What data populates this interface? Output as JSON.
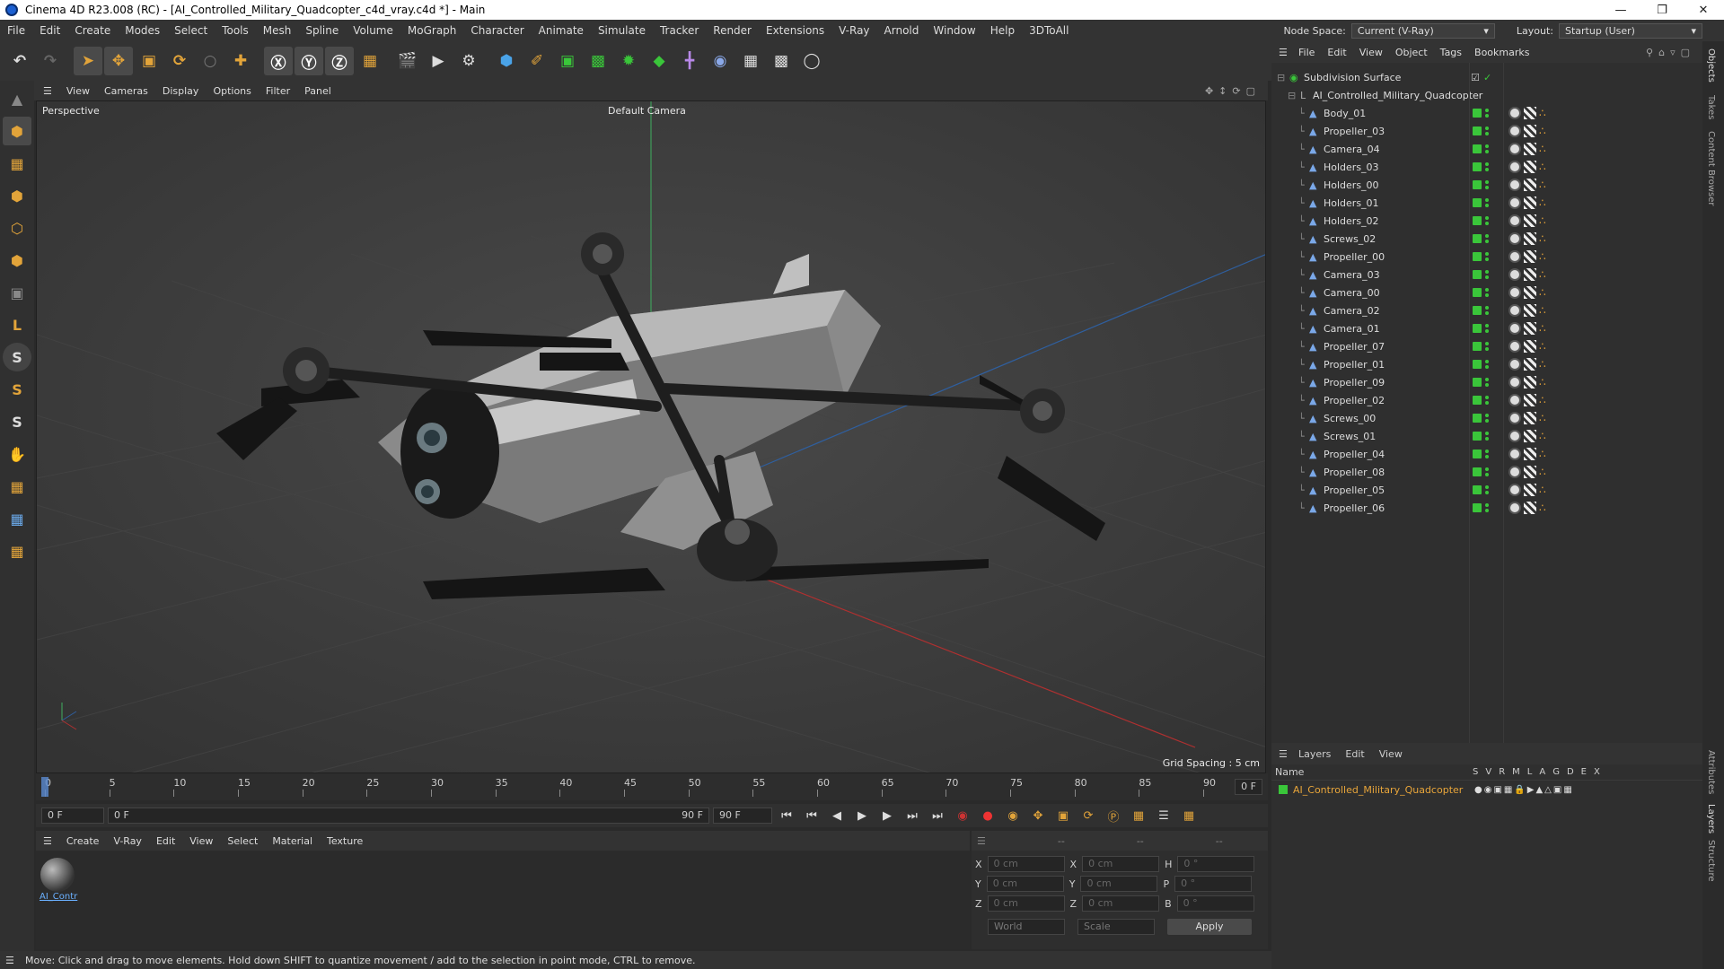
{
  "window": {
    "title": "Cinema 4D R23.008 (RC) - [AI_Controlled_Military_Quadcopter_c4d_vray.c4d *] - Main"
  },
  "menu": [
    "File",
    "Edit",
    "Create",
    "Modes",
    "Select",
    "Tools",
    "Mesh",
    "Spline",
    "Volume",
    "MoGraph",
    "Character",
    "Animate",
    "Simulate",
    "Tracker",
    "Render",
    "Extensions",
    "V-Ray",
    "Arnold",
    "Window",
    "Help",
    "3DToAll"
  ],
  "node_space": {
    "label": "Node Space:",
    "value": "Current (V-Ray)"
  },
  "layout": {
    "label": "Layout:",
    "value": "Startup (User)"
  },
  "viewport": {
    "menu": [
      "View",
      "Cameras",
      "Display",
      "Options",
      "Filter",
      "Panel"
    ],
    "label": "Perspective",
    "camera": "Default Camera",
    "grid_spacing": "Grid Spacing : 5 cm"
  },
  "timeline": {
    "ticks": [
      "0",
      "5",
      "10",
      "15",
      "20",
      "25",
      "30",
      "35",
      "40",
      "45",
      "50",
      "55",
      "60",
      "65",
      "70",
      "75",
      "80",
      "85",
      "90"
    ],
    "current_field": "0 F",
    "start": "0 F",
    "range_start": "0 F",
    "range_end": "90 F",
    "end": "90 F"
  },
  "material_panel": {
    "menu": [
      "Create",
      "V-Ray",
      "Edit",
      "View",
      "Select",
      "Material",
      "Texture"
    ],
    "material_name": "AI_Contr"
  },
  "coords": {
    "rows": [
      {
        "axis": "X",
        "pos": "0 cm",
        "axis2": "X",
        "size": "0 cm",
        "axis3": "H",
        "rot": "0 °"
      },
      {
        "axis": "Y",
        "pos": "0 cm",
        "axis2": "Y",
        "size": "0 cm",
        "axis3": "P",
        "rot": "0 °"
      },
      {
        "axis": "Z",
        "pos": "0 cm",
        "axis2": "Z",
        "size": "0 cm",
        "axis3": "B",
        "rot": "0 °"
      }
    ],
    "mode": "World",
    "scale": "Scale",
    "apply": "Apply",
    "header": [
      "--",
      "--",
      "--"
    ]
  },
  "status": "Move: Click and drag to move elements. Hold down SHIFT to quantize movement / add to the selection in point mode, CTRL to remove.",
  "objects": {
    "menu": [
      "File",
      "Edit",
      "View",
      "Object",
      "Tags",
      "Bookmarks"
    ],
    "root": "Subdivision Surface",
    "group": "AI_Controlled_Military_Quadcopter",
    "items": [
      "Body_01",
      "Propeller_03",
      "Camera_04",
      "Holders_03",
      "Holders_00",
      "Holders_01",
      "Holders_02",
      "Screws_02",
      "Propeller_00",
      "Camera_03",
      "Camera_00",
      "Camera_02",
      "Camera_01",
      "Propeller_07",
      "Propeller_01",
      "Propeller_09",
      "Propeller_02",
      "Screws_00",
      "Screws_01",
      "Propeller_04",
      "Propeller_08",
      "Propeller_05",
      "Propeller_06"
    ]
  },
  "layers": {
    "menu": [
      "Layers",
      "Edit",
      "View"
    ],
    "columns": [
      "Name",
      "S",
      "V",
      "R",
      "M",
      "L",
      "A",
      "G",
      "D",
      "E",
      "X"
    ],
    "item": "AI_Controlled_Military_Quadcopter"
  },
  "right_tabs": [
    "Objects",
    "Takes",
    "Content Browser",
    "Attributes",
    "Layers",
    "Structure"
  ],
  "colors": {
    "accent": "#3ac63a",
    "layer_text": "#e8a53a",
    "grid_red": "#b03030",
    "grid_blue": "#2f5f9f",
    "grid_green": "#3fae5f"
  }
}
